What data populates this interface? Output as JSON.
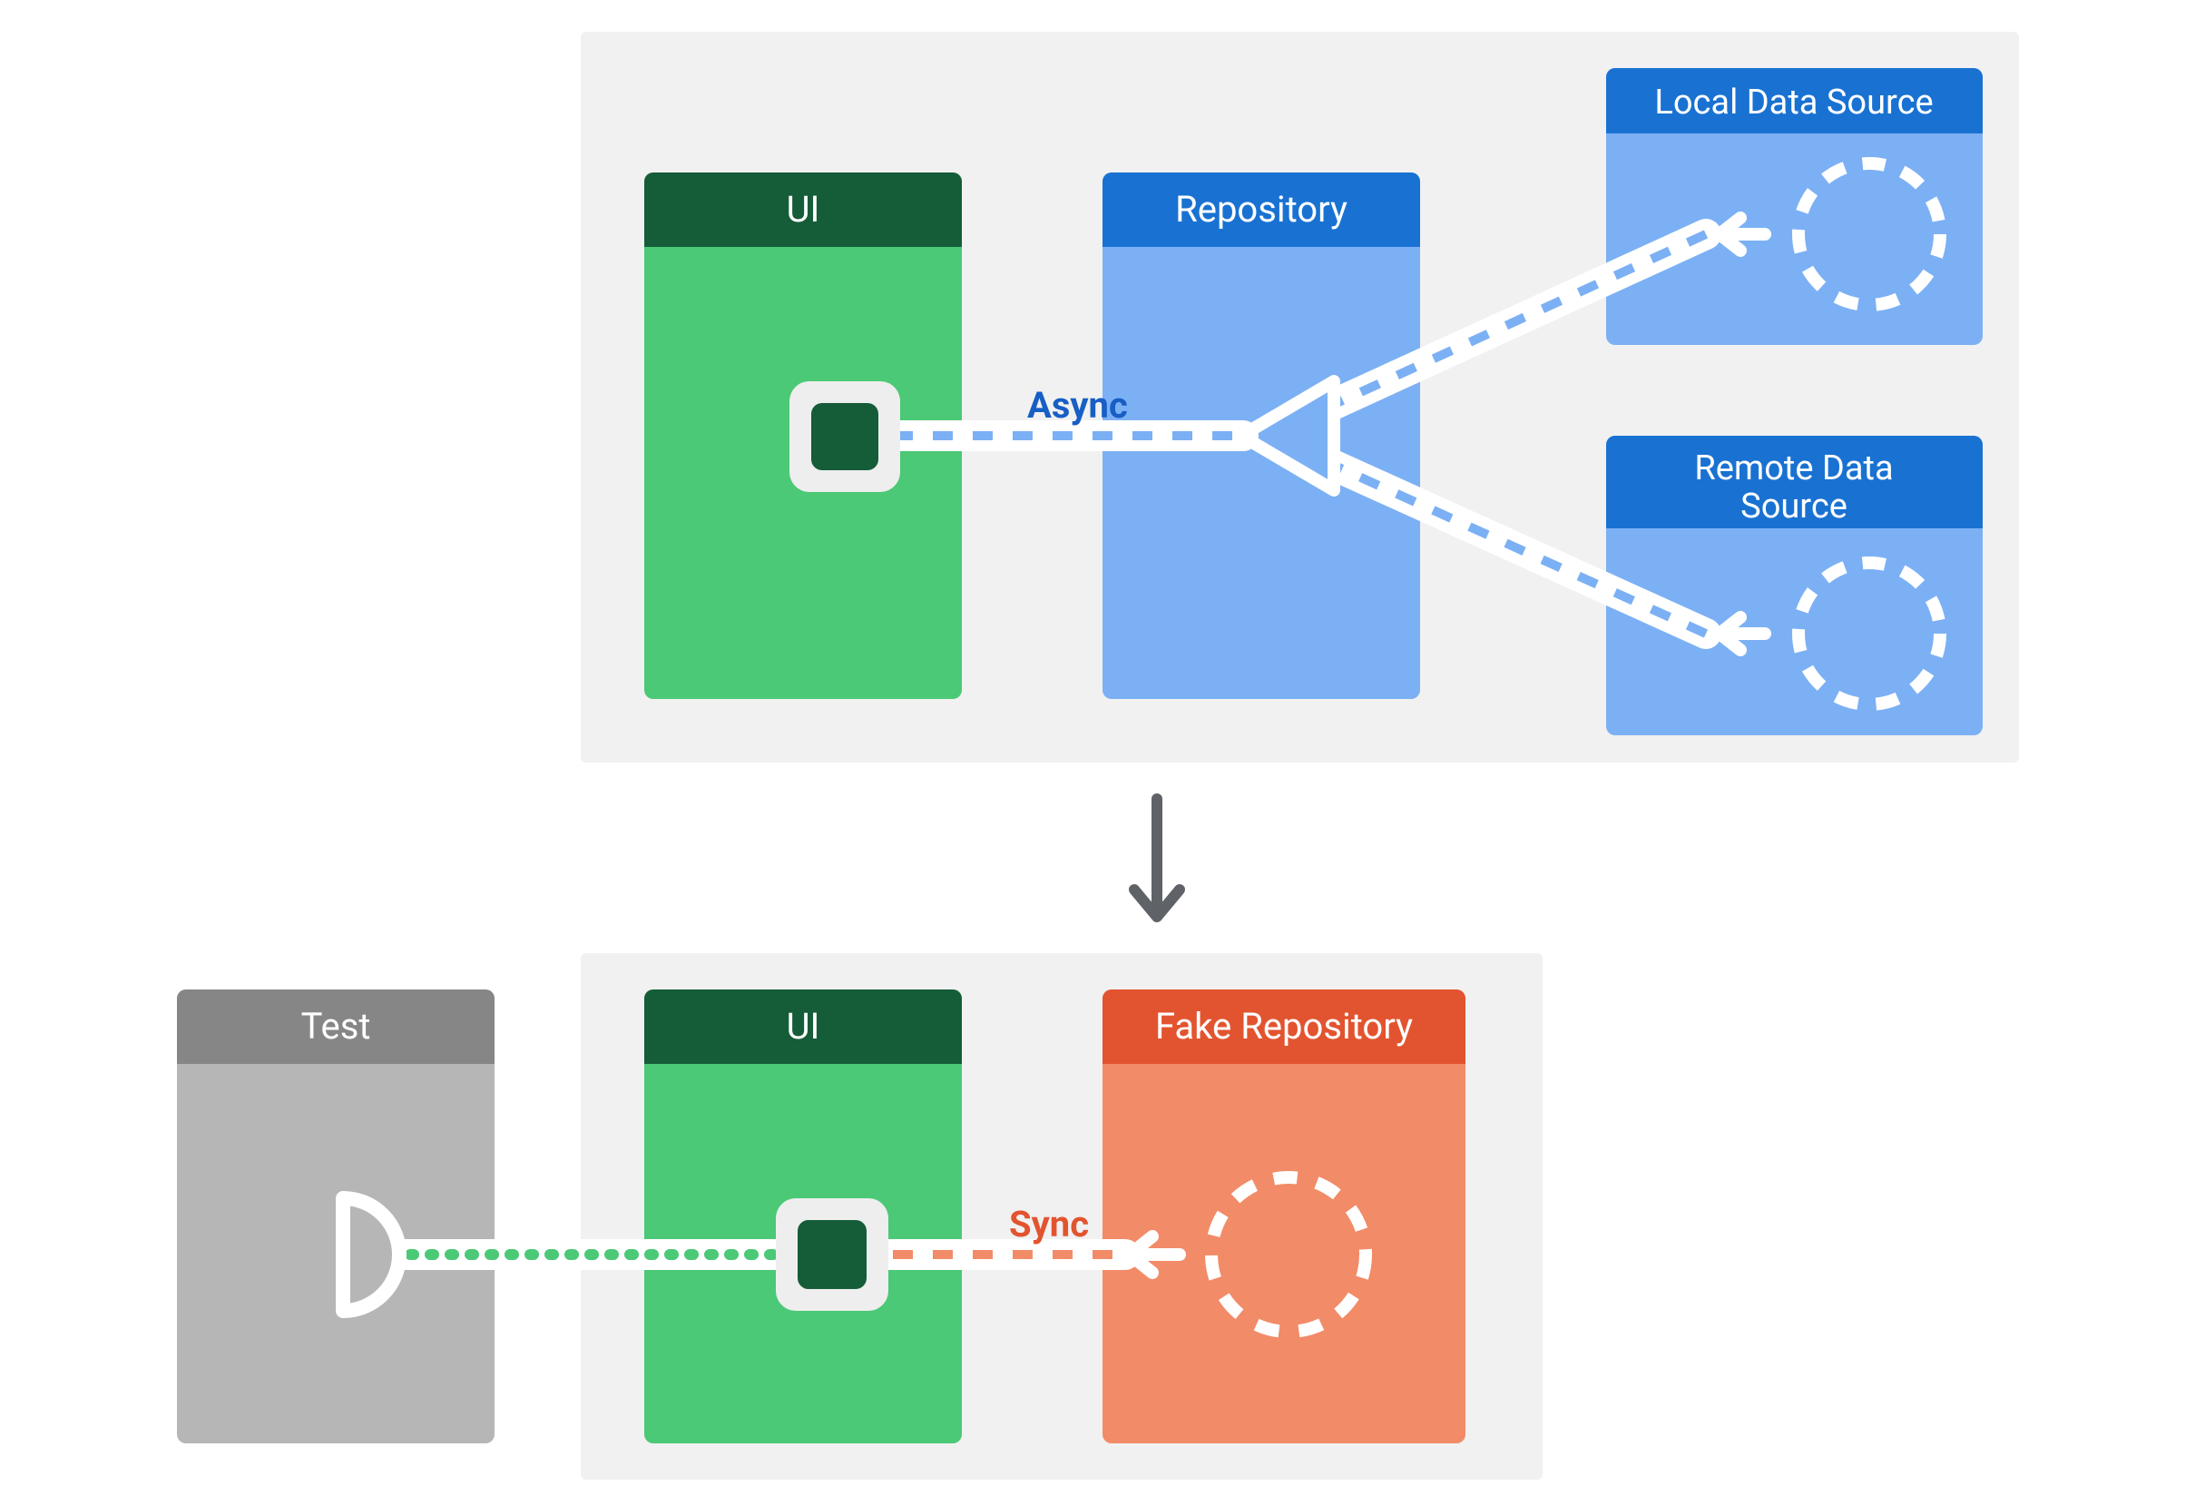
{
  "top": {
    "ui_label": "UI",
    "repository_label": "Repository",
    "local_label": "Local Data Source",
    "remote_label_line1": "Remote Data",
    "remote_label_line2": "Source",
    "async_label": "Async"
  },
  "bottom": {
    "test_label": "Test",
    "ui_label": "UI",
    "fake_repo_label": "Fake Repository",
    "sync_label": "Sync"
  },
  "colors": {
    "panel_bg": "#f1f1f1",
    "green_header": "#155c39",
    "green_body": "#4bc976",
    "blue_header": "#1972d2",
    "blue_body": "#7cb0f4",
    "orange_header": "#e2542f",
    "orange_body": "#f28b67",
    "gray_header": "#868686",
    "gray_body": "#b6b6b6",
    "white": "#ffffff",
    "arrow_dark": "#5f6368",
    "async_text": "#175ec5",
    "sync_text": "#e2542f",
    "port_outer": "#eeeeee",
    "dark_green": "#155c39"
  }
}
